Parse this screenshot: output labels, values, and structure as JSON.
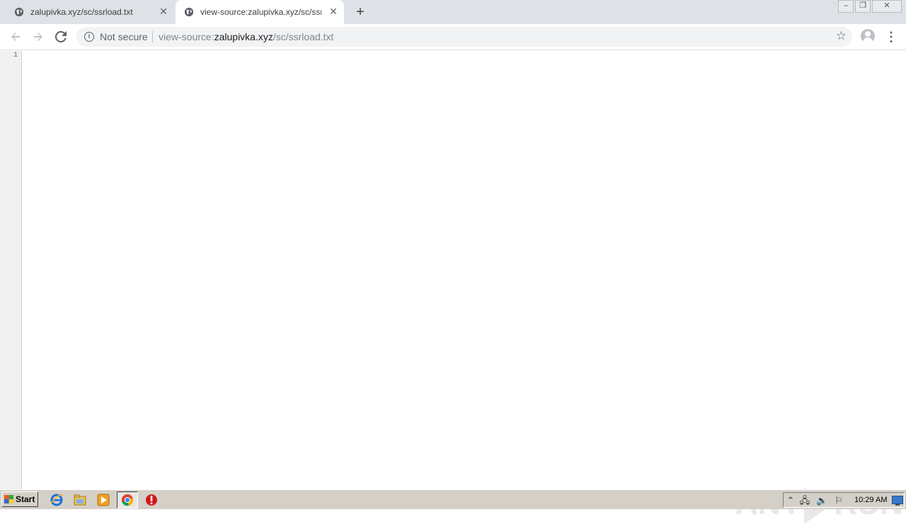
{
  "tabs": [
    {
      "title": "zalupivka.xyz/sc/ssrload.txt",
      "active": false,
      "icon": "globe-icon"
    },
    {
      "title": "view-source:zalupivka.xyz/sc/ssrload.txt",
      "active": true,
      "icon": "globe-icon"
    }
  ],
  "toolbar": {
    "security_label": "Not secure",
    "url_prefix": "view-source:",
    "url_host": "zalupivka.xyz",
    "url_path": "/sc/ssrload.txt"
  },
  "source": {
    "line_numbers": [
      "1"
    ]
  },
  "watermark": {
    "left": "ANY",
    "right": "RUN"
  },
  "taskbar": {
    "start_label": "Start",
    "clock": "10:29 AM"
  },
  "colors": {
    "tabstrip": "#dee1e6",
    "omnibox": "#f1f3f4",
    "taskbar": "#d4d0c8"
  }
}
